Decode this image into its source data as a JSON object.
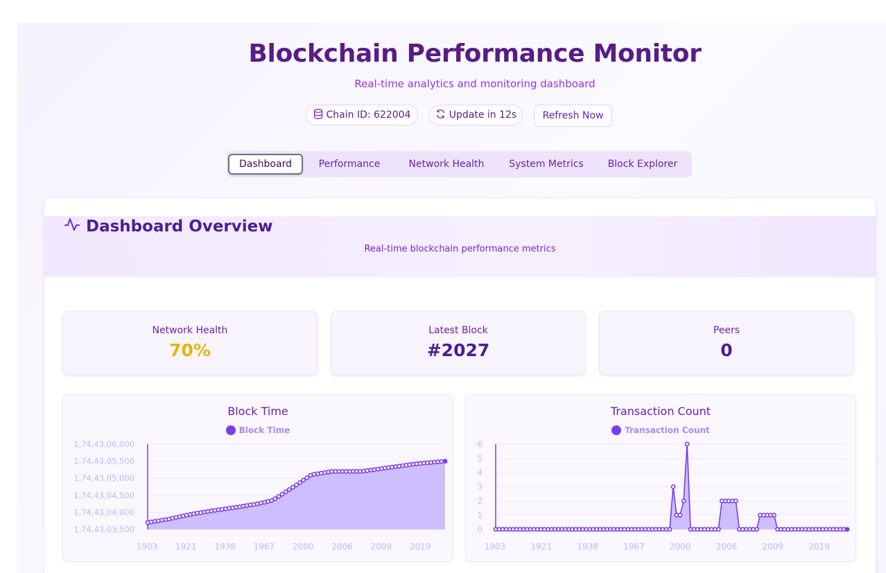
{
  "header": {
    "title": "Blockchain Performance Monitor",
    "subtitle": "Real-time analytics and monitoring dashboard",
    "chain_id": "Chain ID: 622004",
    "update": "Update in 12s",
    "refresh_label": "Refresh Now"
  },
  "tabs": [
    "Dashboard",
    "Performance",
    "Network Health",
    "System Metrics",
    "Block Explorer"
  ],
  "active_tab": "Dashboard",
  "overview": {
    "title": "Dashboard Overview",
    "subtitle": "Real-time blockchain performance metrics"
  },
  "stats": [
    {
      "label": "Network Health",
      "value": "70%",
      "color": "#eab308"
    },
    {
      "label": "Latest Block",
      "value": "#2027",
      "color": "#4c1d95"
    },
    {
      "label": "Peers",
      "value": "0",
      "color": "#4c1d95"
    }
  ],
  "colors": {
    "accent": "#7c3aed",
    "fill": "#c4b5fd",
    "text": "#581c87"
  },
  "chart_data": [
    {
      "type": "area",
      "title": "Block Time",
      "legend": "Block Time",
      "x_ticks": [
        "1903",
        "1921",
        "1938",
        "1967",
        "2000",
        "2006",
        "2009",
        "2019"
      ],
      "y_ticks": [
        "1,74,43,03,500",
        "1,74,43,04,000",
        "1,74,43,04,500",
        "1,74,43,05,000",
        "1,74,43,05,500",
        "1,74,43,06,000"
      ],
      "ylim": [
        1744303500,
        1744306000
      ],
      "points": 85,
      "values": [
        [
          0,
          1744303700
        ],
        [
          7,
          1744303800
        ],
        [
          15,
          1744303950
        ],
        [
          22,
          1744304050
        ],
        [
          30,
          1744304150
        ],
        [
          37,
          1744304250
        ],
        [
          42,
          1744304350
        ],
        [
          50,
          1744304800
        ],
        [
          55,
          1744305100
        ],
        [
          62,
          1744305200
        ],
        [
          72,
          1744305200
        ],
        [
          80,
          1744305300
        ],
        [
          90,
          1744305420
        ],
        [
          100,
          1744305500
        ]
      ]
    },
    {
      "type": "area",
      "title": "Transaction Count",
      "legend": "Transaction Count",
      "x_ticks": [
        "1903",
        "1921",
        "1938",
        "1967",
        "2000",
        "2006",
        "2009",
        "2019"
      ],
      "y_ticks": [
        "0",
        "1",
        "2",
        "3",
        "4",
        "5",
        "6"
      ],
      "ylim": [
        0,
        6
      ],
      "values": [
        0,
        0,
        0,
        0,
        0,
        0,
        0,
        0,
        0,
        0,
        0,
        0,
        0,
        0,
        0,
        0,
        0,
        0,
        0,
        0,
        0,
        0,
        0,
        0,
        0,
        0,
        0,
        0,
        0,
        0,
        0,
        0,
        0,
        0,
        0,
        0,
        0,
        0,
        0,
        0,
        0,
        0,
        0,
        0,
        0,
        0,
        0,
        0,
        0,
        0,
        0,
        3,
        1,
        1,
        2,
        6,
        0,
        0,
        0,
        0,
        0,
        0,
        0,
        0,
        0,
        2,
        2,
        2,
        2,
        2,
        0,
        0,
        0,
        0,
        0,
        0,
        1,
        1,
        1,
        1,
        1,
        0,
        0,
        0,
        0,
        0,
        0,
        0,
        0,
        0,
        0,
        0,
        0,
        0,
        0,
        0,
        0,
        0,
        0,
        0,
        0,
        0
      ]
    }
  ]
}
